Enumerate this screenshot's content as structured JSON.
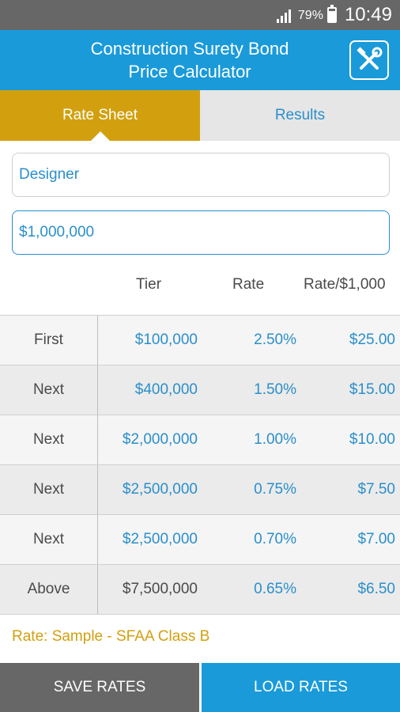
{
  "status_bar": {
    "battery": "79%",
    "time": "10:49"
  },
  "app_bar": {
    "title_line1": "Construction Surety Bond",
    "title_line2": "Price Calculator",
    "tools_icon": "wrench-hammer-icon"
  },
  "tabs": [
    {
      "label": "Rate Sheet",
      "active": true
    },
    {
      "label": "Results",
      "active": false
    }
  ],
  "form": {
    "name_value": "Designer",
    "amount_value": "$1,000,000"
  },
  "table": {
    "headers": {
      "tier": "Tier",
      "rate": "Rate",
      "per_thousand": "Rate/$1,000"
    },
    "rows": [
      {
        "label": "First",
        "tier": "$100,000",
        "rate": "2.50%",
        "per_thousand": "$25.00"
      },
      {
        "label": "Next",
        "tier": "$400,000",
        "rate": "1.50%",
        "per_thousand": "$15.00"
      },
      {
        "label": "Next",
        "tier": "$2,000,000",
        "rate": "1.00%",
        "per_thousand": "$10.00"
      },
      {
        "label": "Next",
        "tier": "$2,500,000",
        "rate": "0.75%",
        "per_thousand": "$7.50"
      },
      {
        "label": "Next",
        "tier": "$2,500,000",
        "rate": "0.70%",
        "per_thousand": "$7.00"
      },
      {
        "label": "Above",
        "tier": "$7,500,000",
        "rate": "0.65%",
        "per_thousand": "$6.50"
      }
    ]
  },
  "rate_note": "Rate: Sample - SFAA Class B",
  "buttons": {
    "save": "SAVE RATES",
    "load": "LOAD RATES"
  },
  "colors": {
    "primary": "#1a9ad9",
    "accent": "#d2a00e",
    "gray_bar": "#676767"
  }
}
